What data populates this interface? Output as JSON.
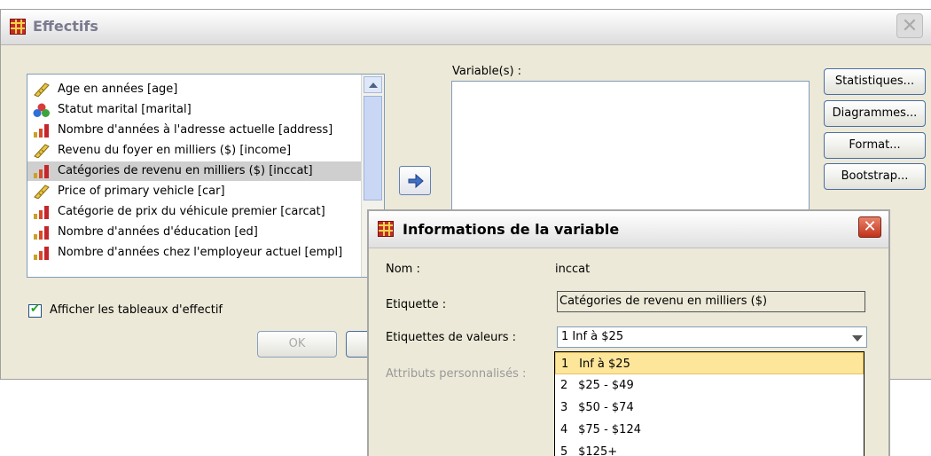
{
  "main_dialog": {
    "title": "Effectifs",
    "source_items": [
      {
        "label": "Age en années [age]",
        "icon": "scale-ruler-icon"
      },
      {
        "label": "Statut marital [marital]",
        "icon": "nominal-circles-icon"
      },
      {
        "label": "Nombre d'années à l'adresse actuelle [address]",
        "icon": "ordinal-bars-icon"
      },
      {
        "label": "Revenu du foyer en milliers ($) [income]",
        "icon": "scale-ruler-icon"
      },
      {
        "label": "Catégories de revenu en milliers ($) [inccat]",
        "icon": "ordinal-bars-icon"
      },
      {
        "label": "Price of primary vehicle [car]",
        "icon": "scale-ruler-icon"
      },
      {
        "label": "Catégorie de prix du véhicule premier [carcat]",
        "icon": "ordinal-bars-icon"
      },
      {
        "label": "Nombre d'années d'éducation [ed]",
        "icon": "ordinal-bars-icon"
      },
      {
        "label": "Nombre d'années chez l'employeur actuel [empl]",
        "icon": "ordinal-bars-icon"
      }
    ],
    "selected_index": 4,
    "variables_label": "Variable(s) :",
    "checkbox_label": "Afficher les tableaux d'effectif",
    "checkbox_checked": true,
    "buttons": {
      "statistiques": "Statistiques...",
      "diagrammes": "Diagrammes...",
      "format": "Format...",
      "bootstrap": "Bootstrap...",
      "ok": "OK"
    }
  },
  "info_dialog": {
    "title": "Informations de la variable",
    "nom_label": "Nom :",
    "nom_value": "inccat",
    "etiquette_label": "Etiquette :",
    "etiquette_value": "Catégories de revenu en milliers ($)",
    "valeurs_label": "Etiquettes de valeurs :",
    "combo_value": "1   Inf à $25",
    "attributs_label": "Attributs personnalisés :",
    "options": [
      {
        "num": "1",
        "label": "Inf à $25"
      },
      {
        "num": "2",
        "label": "$25 - $49"
      },
      {
        "num": "3",
        "label": "$50 - $74"
      },
      {
        "num": "4",
        "label": "$75 - $124"
      },
      {
        "num": "5",
        "label": "$125+"
      }
    ],
    "selected_option": 0
  },
  "colors": {
    "dialog_bg": "#ece9d8",
    "selection": "#cfcfcf",
    "dropdown_highlight": "#fde69a",
    "close_red": "#c2331b"
  }
}
